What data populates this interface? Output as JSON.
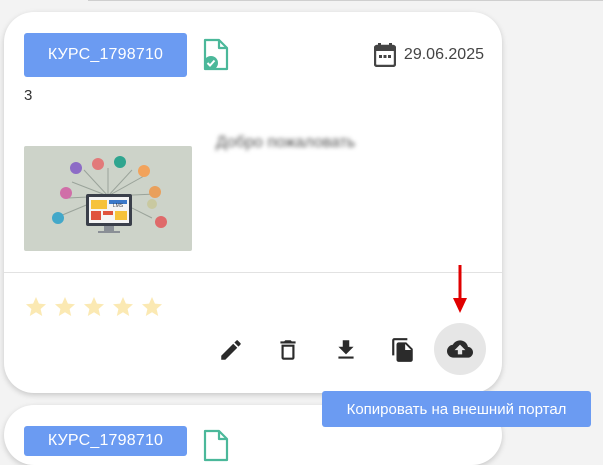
{
  "course_card": {
    "course_code": "КУРС_1798710",
    "date": "29.06.2025",
    "count": "3",
    "title_blurred": "Добро пожаловать",
    "thumbnail_label": "LMS",
    "rating": 0,
    "rating_max": 5
  },
  "next_card": {
    "course_code": "КУРС_1798710"
  },
  "actions": {
    "edit_icon": "pencil-icon",
    "delete_icon": "trash-icon",
    "download_icon": "download-icon",
    "copy_icon": "copy-icon",
    "upload_icon": "cloud-upload-icon"
  },
  "tooltip": {
    "text": "Копировать на внешний портал"
  },
  "colors": {
    "chip": "#6b9bf2",
    "file_icon": "#4bb89a",
    "star": "#fbe9b3",
    "arrow": "#e00000",
    "active_button_bg": "#e6e6e6"
  }
}
